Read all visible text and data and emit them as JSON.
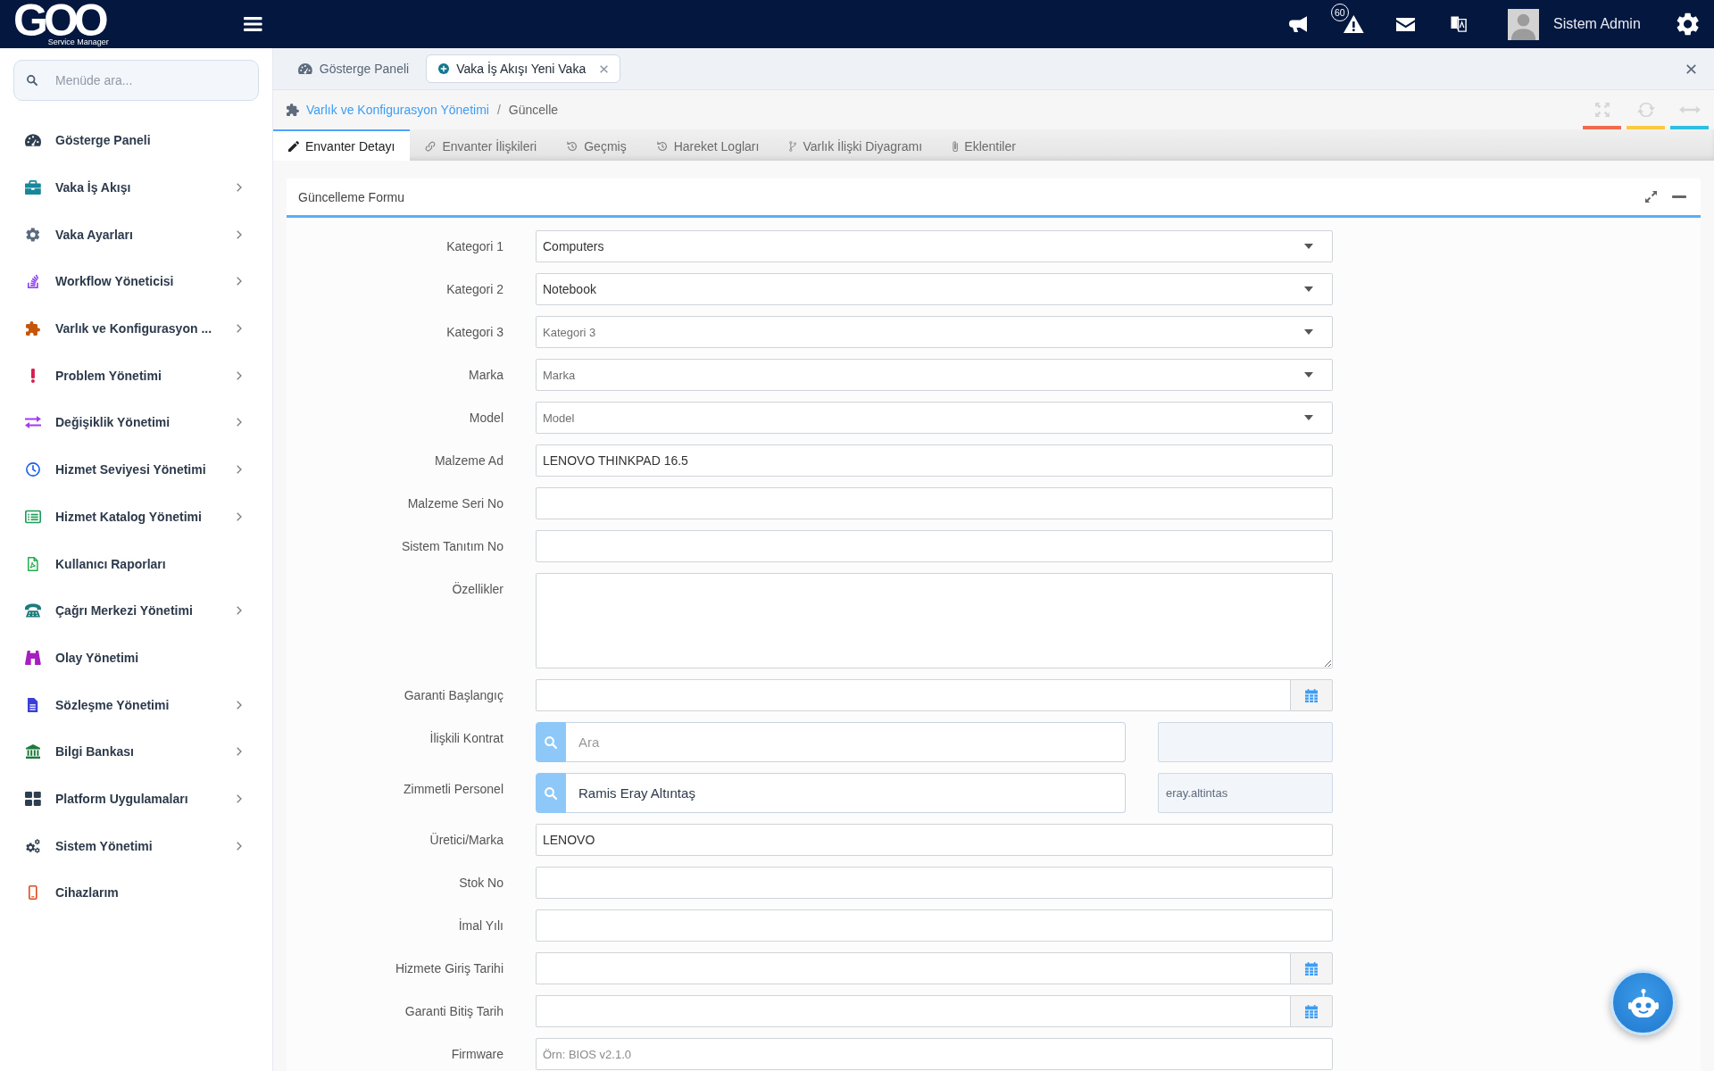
{
  "top_bar": {
    "logo": {
      "wordmark": "GOO",
      "tagline": "Service Manager"
    },
    "alert_count": "60",
    "user_name": "Sistem Admin"
  },
  "sidebar": {
    "search": {
      "placeholder": "Menüde ara..."
    },
    "items": [
      {
        "label": "Gösterge Paneli",
        "expandable": false
      },
      {
        "label": "Vaka İş Akışı",
        "expandable": true
      },
      {
        "label": "Vaka Ayarları",
        "expandable": true
      },
      {
        "label": "Workflow Yöneticisi",
        "expandable": true
      },
      {
        "label": "Varlık ve Konfigurasyon ...",
        "expandable": true
      },
      {
        "label": "Problem Yönetimi",
        "expandable": true
      },
      {
        "label": "Değişiklik Yönetimi",
        "expandable": true
      },
      {
        "label": "Hizmet Seviyesi Yönetimi",
        "expandable": true
      },
      {
        "label": "Hizmet Katalog Yönetimi",
        "expandable": true
      },
      {
        "label": "Kullanıcı Raporları",
        "expandable": false
      },
      {
        "label": "Çağrı Merkezi Yönetimi",
        "expandable": true
      },
      {
        "label": "Olay Yönetimi",
        "expandable": false
      },
      {
        "label": "Sözleşme Yönetimi",
        "expandable": true
      },
      {
        "label": "Bilgi Bankası",
        "expandable": true
      },
      {
        "label": "Platform Uygulamaları",
        "expandable": true
      },
      {
        "label": "Sistem Yönetimi",
        "expandable": true
      },
      {
        "label": "Cihazlarım",
        "expandable": false
      }
    ]
  },
  "page_tabs": [
    {
      "label": "Gösterge Paneli",
      "selected": false,
      "closable": false
    },
    {
      "label": "Vaka İş Akışı Yeni Vaka",
      "selected": true,
      "closable": true
    }
  ],
  "breadcrumb": {
    "items": [
      {
        "label": "Varlık ve Konfigurasyon Yönetimi",
        "kind": "link"
      },
      {
        "label": "Güncelle",
        "kind": "current"
      }
    ],
    "separator": "/"
  },
  "detail_tabs": [
    {
      "label": "Envanter Detayı",
      "selected": true
    },
    {
      "label": "Envanter İlişkileri",
      "selected": false
    },
    {
      "label": "Geçmiş",
      "selected": false
    },
    {
      "label": "Hareket Logları",
      "selected": false
    },
    {
      "label": "Varlık İlişki Diyagramı",
      "selected": false
    },
    {
      "label": "Eklentiler",
      "selected": false
    }
  ],
  "panel": {
    "title": "Güncelleme Formu",
    "fields": [
      {
        "kind": "select",
        "label": "Kategori 1",
        "value": "Computers"
      },
      {
        "kind": "select",
        "label": "Kategori 2",
        "value": "Notebook"
      },
      {
        "kind": "select",
        "label": "Kategori 3",
        "placeholder": "Kategori 3"
      },
      {
        "kind": "select",
        "label": "Marka",
        "placeholder": "Marka"
      },
      {
        "kind": "select",
        "label": "Model",
        "placeholder": "Model"
      },
      {
        "kind": "text",
        "label": "Malzeme Ad",
        "value": "LENOVO THINKPAD 16.5"
      },
      {
        "kind": "text",
        "label": "Malzeme Seri No"
      },
      {
        "kind": "text",
        "label": "Sistem Tanıtım No"
      },
      {
        "kind": "textarea",
        "label": "Özellikler"
      },
      {
        "kind": "date",
        "label": "Garanti Başlangıç"
      },
      {
        "kind": "lookup",
        "label": "İlişkili Kontrat",
        "placeholder": "Ara"
      },
      {
        "kind": "lookup",
        "label": "Zimmetli Personel",
        "value": "Ramis Eray Altıntaş",
        "extra_value": "eray.altintas"
      },
      {
        "kind": "text",
        "label": "Üretici/Marka",
        "value": "LENOVO"
      },
      {
        "kind": "text",
        "label": "Stok No"
      },
      {
        "kind": "text",
        "label": "İmal Yılı"
      },
      {
        "kind": "date",
        "label": "Hizmete Giriş Tarihi"
      },
      {
        "kind": "date",
        "label": "Garanti Bitiş Tarih"
      },
      {
        "kind": "text",
        "label": "Firmware",
        "placeholder": "Örn: BIOS v2.1.0"
      }
    ]
  }
}
